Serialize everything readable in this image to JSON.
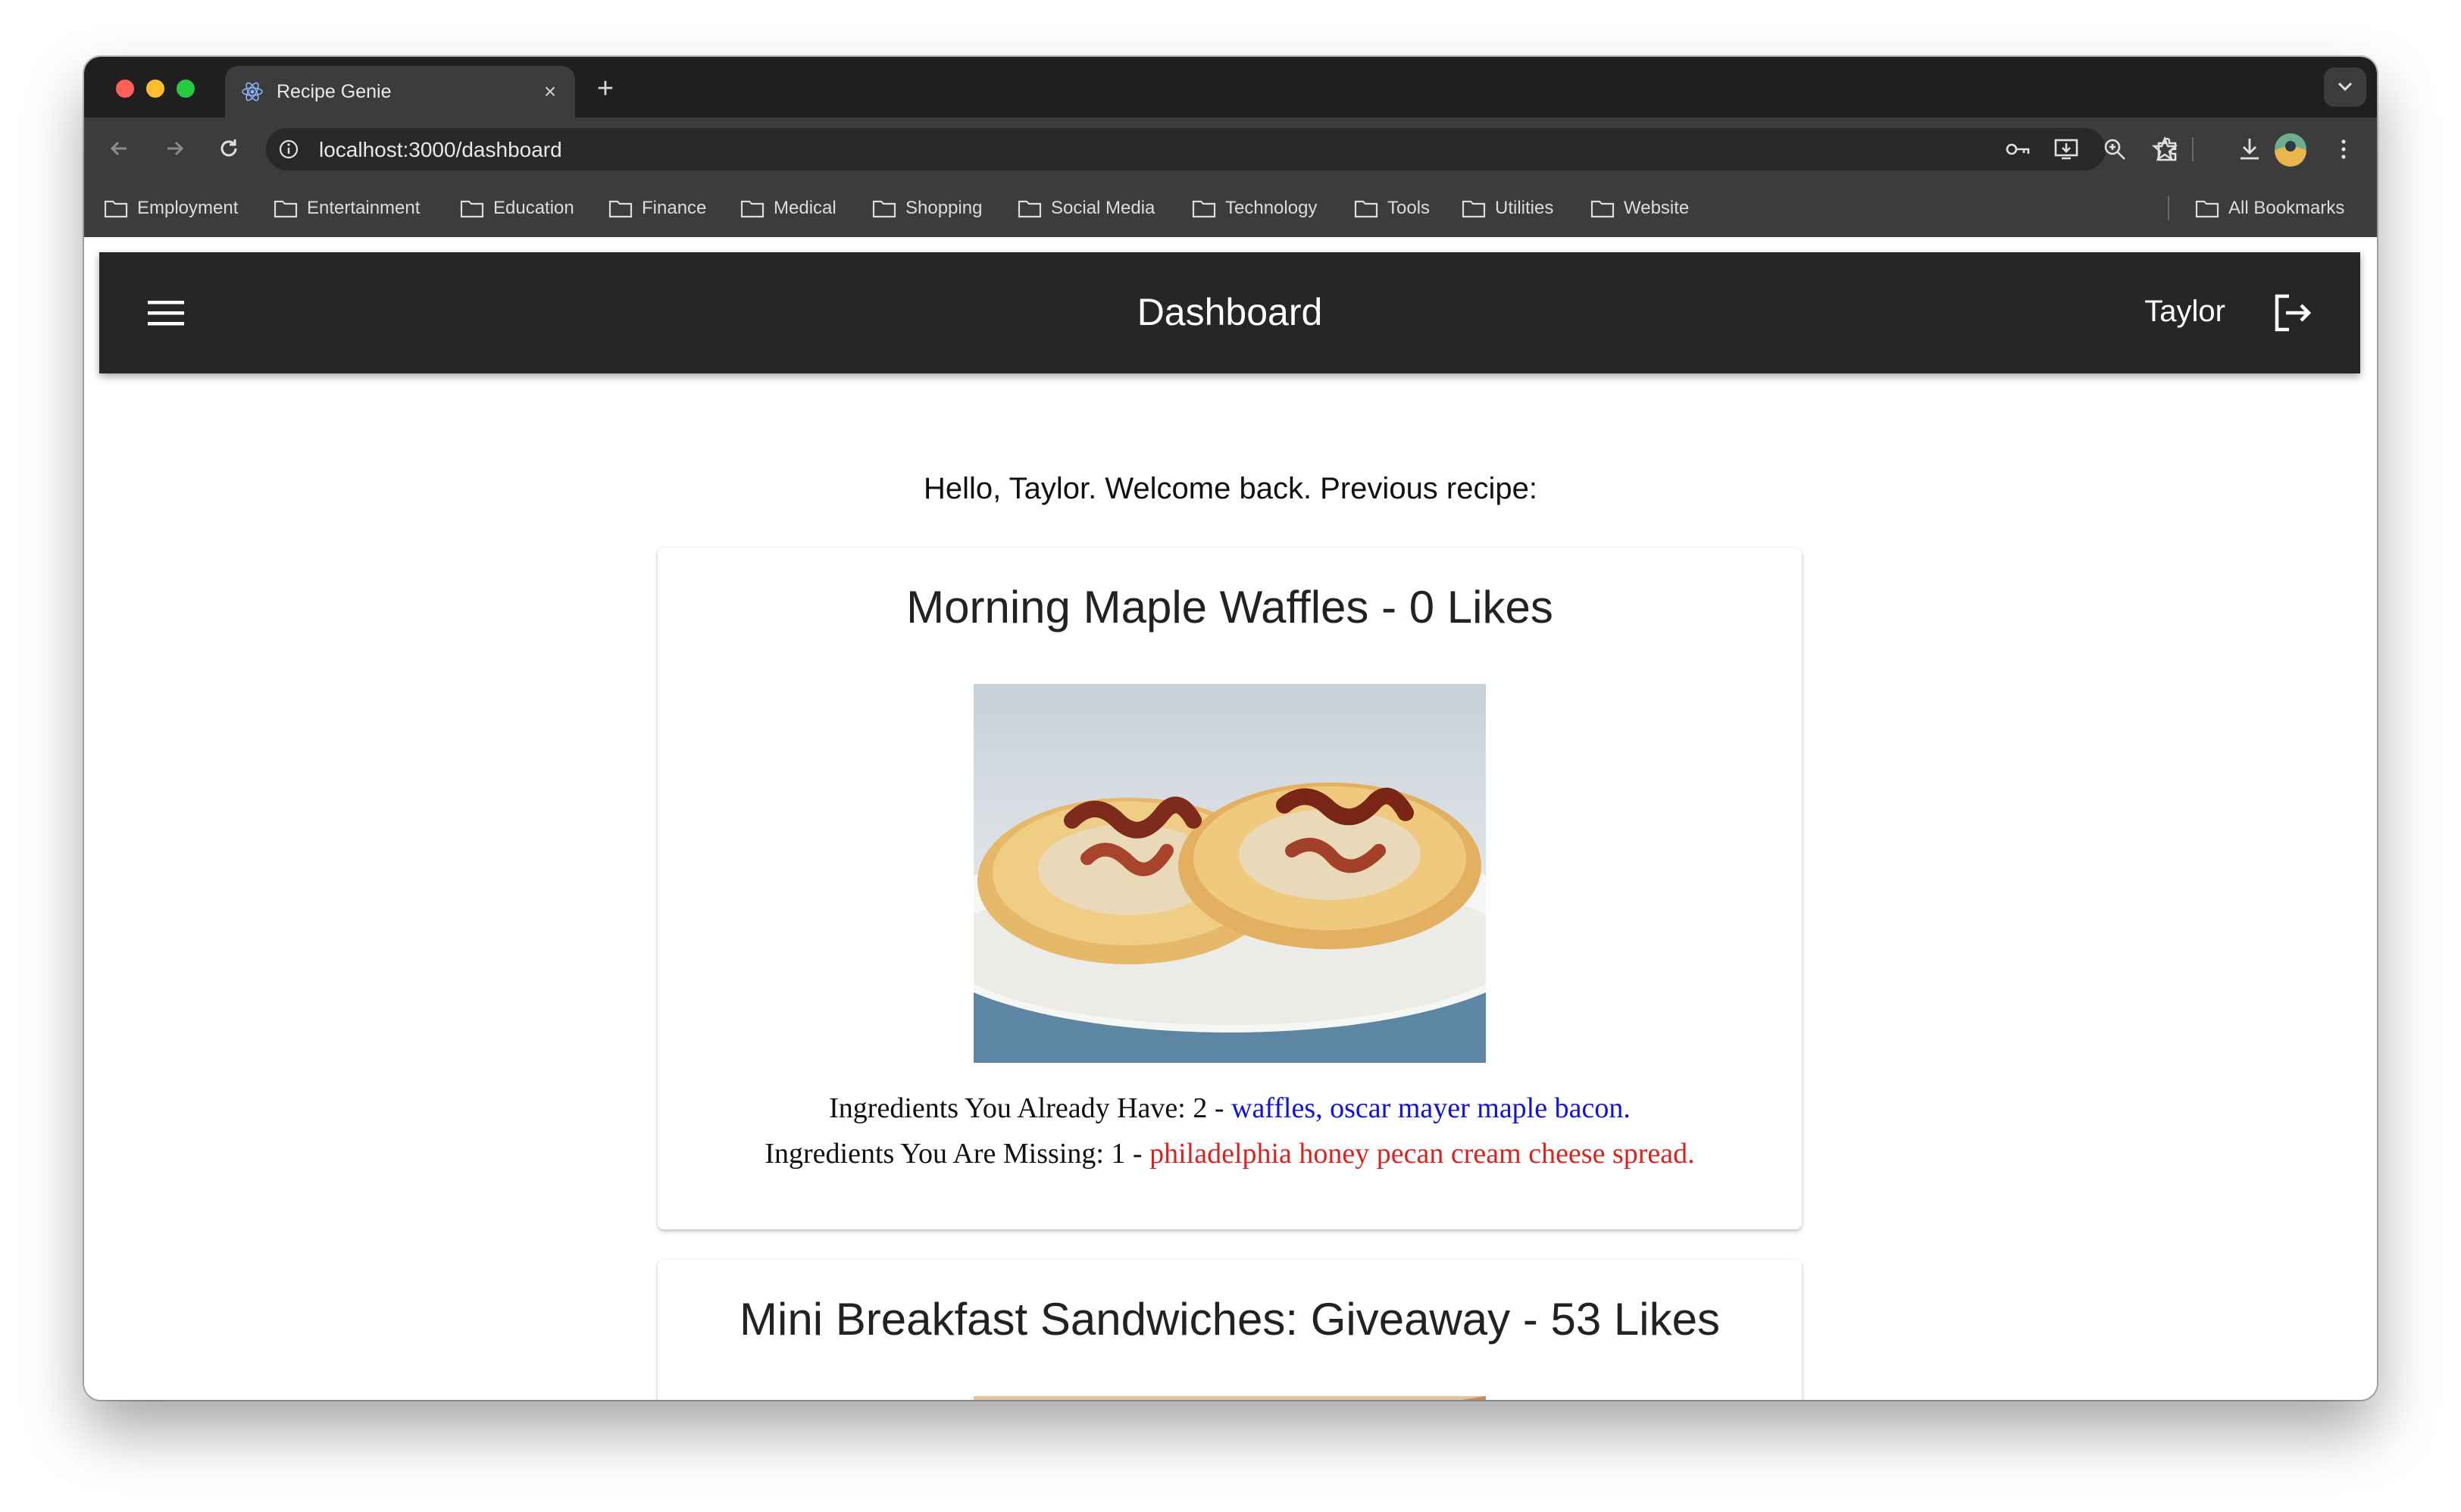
{
  "browser": {
    "tab_title": "Recipe Genie",
    "tab_close": "×",
    "new_tab": "+",
    "url": "localhost:3000/dashboard",
    "bookmarks": [
      "Employment",
      "Entertainment",
      "Education",
      "Finance",
      "Medical",
      "Shopping",
      "Social Media",
      "Technology",
      "Tools",
      "Utilities",
      "Website"
    ],
    "all_bookmarks": "All Bookmarks"
  },
  "appbar": {
    "title": "Dashboard",
    "user": "Taylor"
  },
  "welcome": "Hello, Taylor. Welcome back. Previous recipe:",
  "recipes": [
    {
      "title": "Morning Maple Waffles - 0 Likes",
      "have_label": "Ingredients You Already Have: 2 - ",
      "have_items": "waffles, oscar mayer maple bacon.",
      "missing_label": "Ingredients You Are Missing: 1 - ",
      "missing_items": "philadelphia honey pecan cream cheese spread."
    },
    {
      "title": "Mini Breakfast Sandwiches: Giveaway - 53 Likes"
    }
  ],
  "colors": {
    "have": "#1010e0",
    "missing": "#e0201f",
    "appbar": "#262626"
  }
}
